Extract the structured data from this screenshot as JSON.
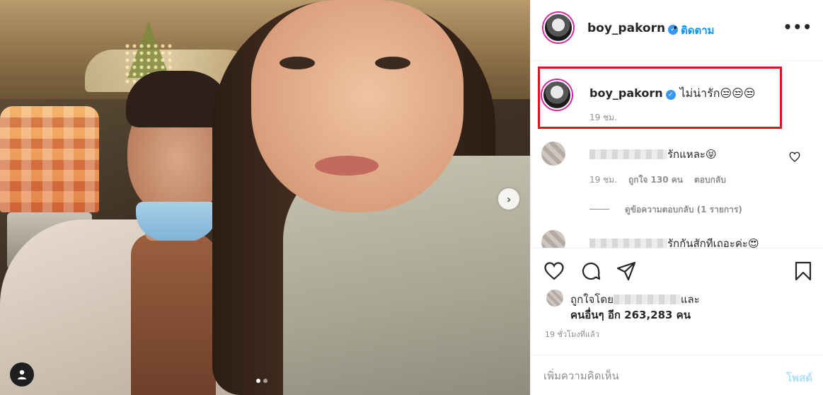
{
  "post": {
    "username": "boy_pakorn",
    "follow_label": "ติดตาม",
    "separator": "•",
    "more_label": "•••",
    "verified_mark": "✓"
  },
  "caption": {
    "username": "boy_pakorn",
    "text": "ไม่น่ารัก😒😒😒",
    "time": "19 ชม."
  },
  "comments": [
    {
      "text": "รักแหละ😝",
      "time": "19 ชม.",
      "likes": "ถูกใจ 130 คน",
      "reply_label": "ตอบกลับ",
      "view_replies": "ดูข้อความตอบกลับ (1 รายการ)"
    },
    {
      "text": "รักกันสักทีเถอะค่ะ😍"
    }
  ],
  "engagement": {
    "liked_by_prefix": "ถูกใจโดย",
    "liked_by_suffix": "และ",
    "others_count": "คนอื่นๆ อีก 263,283 คน",
    "post_time": "19 ชั่วโมงที่แล้ว"
  },
  "add_comment": {
    "placeholder": "เพิ่มความคิดเห็น",
    "post_label": "โพสต์"
  },
  "carousel": {
    "next_label": "›",
    "total_slides": 2,
    "active_slide": 1
  },
  "colors": {
    "accent": "#0095f6",
    "highlight_box": "#e0141e",
    "post_button_disabled": "#b2dffc"
  }
}
